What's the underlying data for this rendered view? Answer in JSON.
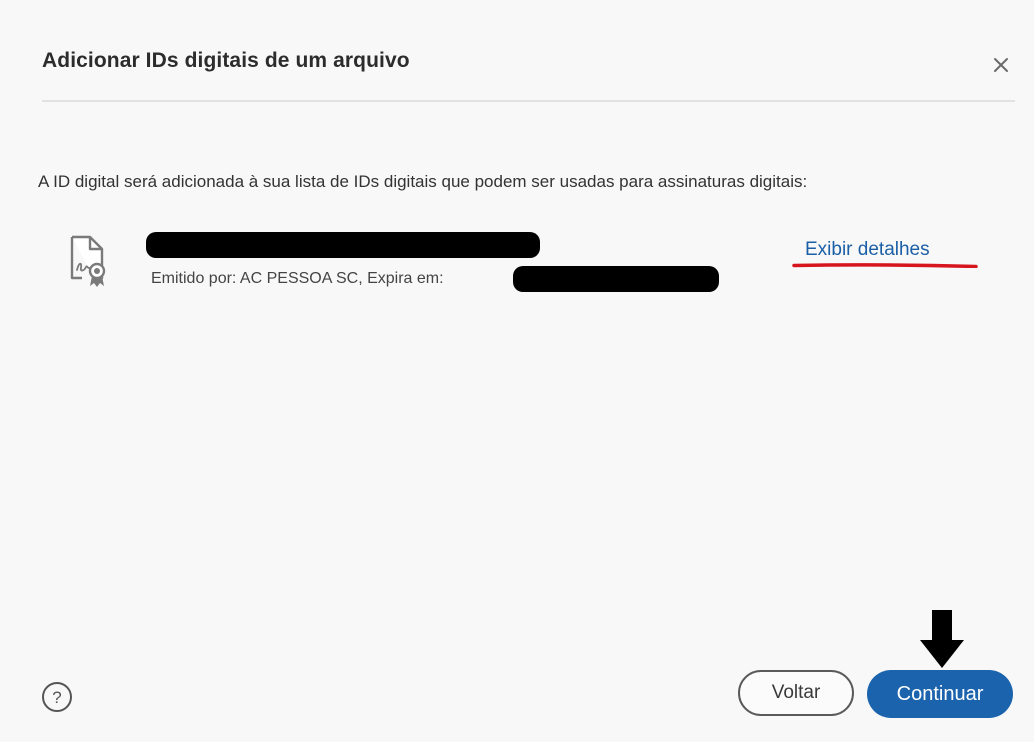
{
  "dialog": {
    "title": "Adicionar IDs digitais de um arquivo",
    "close_icon": "close-icon",
    "description": "A ID digital será adicionada à sua lista de IDs digitais que podem ser usadas para assinaturas digitais:"
  },
  "certificate": {
    "icon": "certificate-document-icon",
    "issuer_text": "Emitido por: AC PESSOA SC, Expira em:",
    "details_link": "Exibir detalhes"
  },
  "footer": {
    "help_icon": "help-icon",
    "back_label": "Voltar",
    "continue_label": "Continuar"
  },
  "annotations": {
    "underline_color": "#d6151e",
    "arrow_icon": "arrow-down-icon"
  },
  "colors": {
    "primary_button": "#1b64ad",
    "link": "#1b5fa7",
    "background": "#f8f8f8"
  }
}
